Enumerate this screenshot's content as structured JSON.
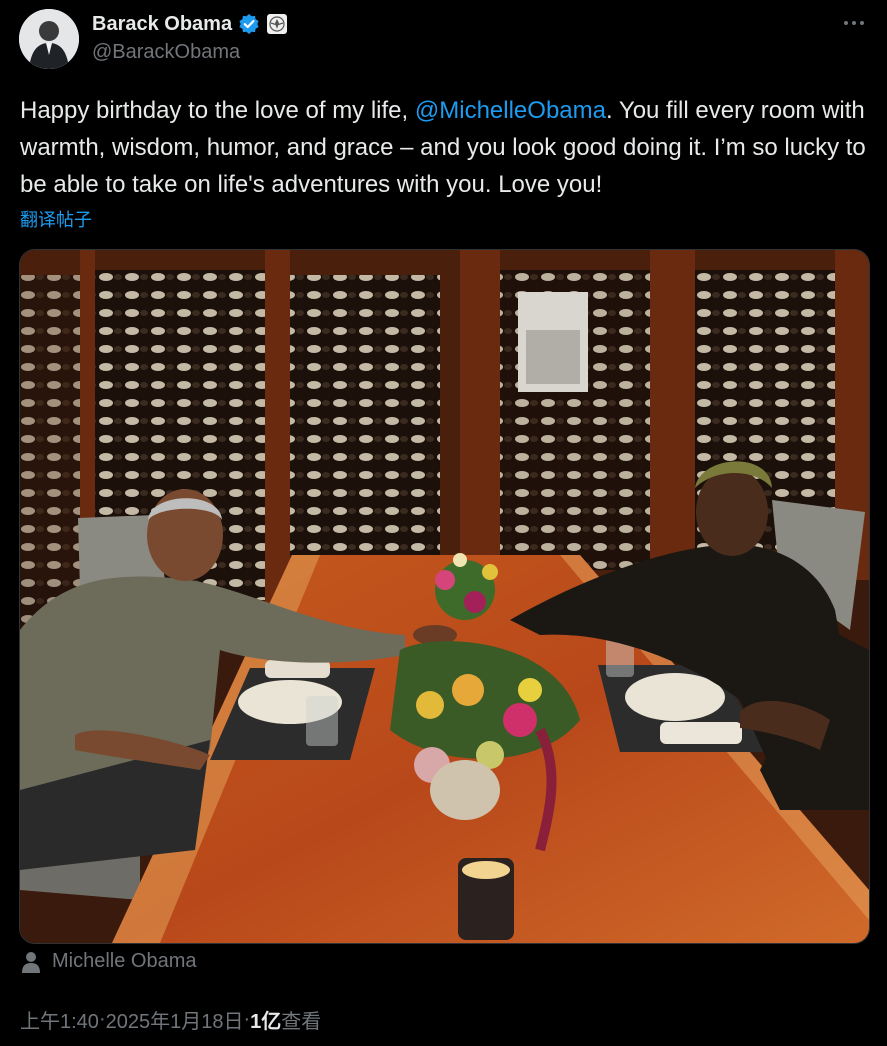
{
  "author": {
    "name": "Barack Obama",
    "handle": "@BarackObama",
    "verified_color": "#1d9bf0"
  },
  "menu": {
    "icon": "more-horizontal-icon"
  },
  "tweet": {
    "text_before": "Happy birthday to the love of my life, ",
    "mention": "@MichelleObama",
    "text_after": ". You fill every room with warmth, wisdom, humor, and grace – and you look good doing it. I’m so lucky to be able to take on life's adventures with you. Love you!"
  },
  "translate_label": "翻译帖子",
  "tagged_user": "Michelle Obama",
  "meta": {
    "time": "上午1:40",
    "sep1": " · ",
    "date": "2025年1月18日",
    "sep2": " · ",
    "views_count": "1亿",
    "views_label": " 查看"
  },
  "colors": {
    "background": "#000000",
    "text": "#e7e9ea",
    "muted": "#71767b",
    "link": "#1d9bf0"
  }
}
